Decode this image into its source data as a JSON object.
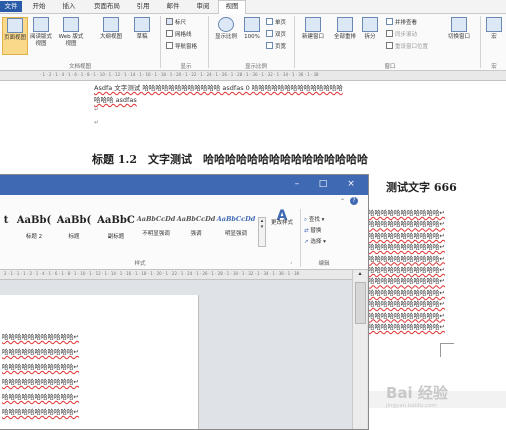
{
  "menubar": {
    "file": "文件",
    "items": [
      "开始",
      "插入",
      "页面布局",
      "引用",
      "邮件",
      "审阅",
      "视图"
    ],
    "active": "视图"
  },
  "ribbon": {
    "doc_views": [
      "页面视图",
      "阅读版式视图",
      "Web 版式视图",
      "大纲视图",
      "草稿"
    ],
    "doc_views_group": "文档视图",
    "show_items": [
      "标尺",
      "网格线",
      "导航窗格"
    ],
    "show_group": "显示",
    "zoom_buttons": [
      "显示比例",
      "100%"
    ],
    "zoom_small": [
      "单页",
      "双页",
      "页宽"
    ],
    "zoom_group": "显示比例",
    "window_buttons": [
      "新建窗口",
      "全部重排",
      "拆分"
    ],
    "window_small": [
      "并排查看",
      "同步滚动",
      "重设窗口位置"
    ],
    "switch_window": "切换窗口",
    "window_group": "窗口",
    "macro": "宏",
    "macro_group": "宏"
  },
  "document": {
    "line1": "Asdfa 文字测试 哈哈哈哈哈哈哈哈哈哈哈哈 asdfas 0 哈哈哈哈哈哈哈哈哈哈哈哈哈哈",
    "line2": "哈哈哈 asdfas",
    "heading": "标题 1.2　文字测试　哈哈哈哈哈哈哈哈哈哈哈哈哈哈哈",
    "heading_tail": "测试文字 666",
    "right_lines": [
      "哈哈哈哈哈哈哈哈哈哈哈",
      "哈哈哈哈哈哈哈哈哈哈哈",
      "哈哈哈哈哈哈哈哈哈哈哈",
      "哈哈哈哈哈哈哈哈哈哈哈",
      "哈哈哈哈哈哈哈哈哈哈哈",
      "哈哈哈哈哈哈哈哈哈哈哈",
      "哈哈哈哈哈哈哈哈哈哈哈",
      "哈哈哈哈哈哈哈哈哈哈哈",
      "哈哈哈哈哈哈哈哈哈哈哈",
      "哈哈哈哈哈哈哈哈哈哈哈",
      "哈哈哈哈哈哈哈哈哈哈哈"
    ]
  },
  "watermark": {
    "brand": "Bai 经验",
    "url": "jingyan.baidu.com"
  },
  "front_window": {
    "styles": [
      {
        "sample": "AaBbC",
        "label": ""
      },
      {
        "sample": "AaBb(",
        "label": "标题 2"
      },
      {
        "sample": "AaBb(",
        "label": "标题"
      },
      {
        "sample": "AaBbC",
        "label": "副标题"
      },
      {
        "sample": "AaBbCcDd",
        "label": "不明显强调"
      },
      {
        "sample": "AaBbCcDd",
        "label": "强调"
      },
      {
        "sample": "AaBbCcDd",
        "label": "明显强调"
      }
    ],
    "change_styles": "更改样式",
    "styles_group": "样式",
    "edit_items": [
      "查找",
      "替换",
      "选择"
    ],
    "edit_group": "编辑",
    "page_lines": [
      "哈哈哈哈哈哈哈哈哈哈哈",
      "哈哈哈哈哈哈哈哈哈哈哈",
      "哈哈哈哈哈哈哈哈哈哈哈",
      "哈哈哈哈哈哈哈哈哈哈哈",
      "哈哈哈哈哈哈哈哈哈哈哈",
      "哈哈哈哈哈哈哈哈哈哈哈"
    ]
  },
  "colors": {
    "title_bar": "#3f6ab3",
    "file_tab": "#2a5ba8",
    "spell_underline": "#e03030"
  }
}
